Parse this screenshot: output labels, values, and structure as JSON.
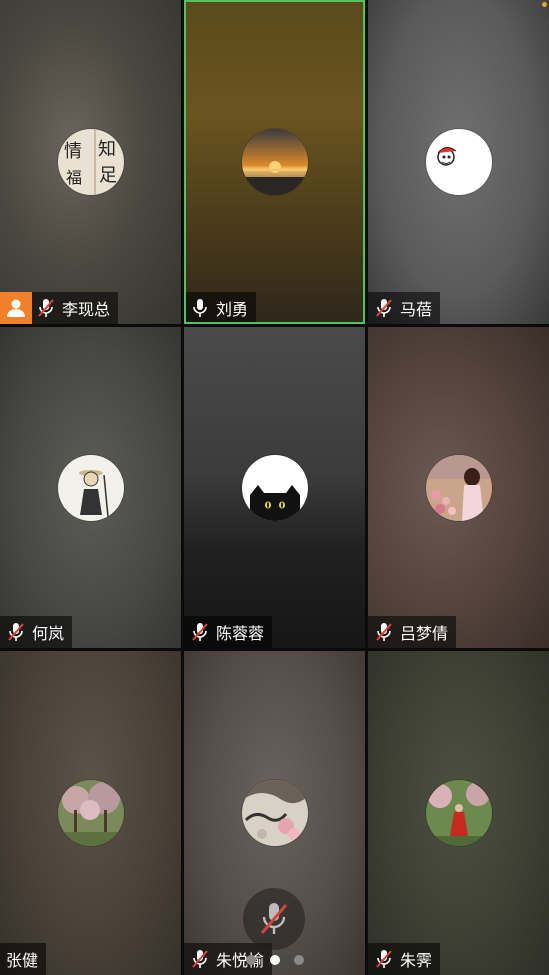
{
  "participants": [
    {
      "name": "李现总",
      "muted": true,
      "host": true,
      "active": false,
      "avatar": "calligraphy-avatar"
    },
    {
      "name": "刘勇",
      "muted": false,
      "host": false,
      "active": true,
      "avatar": "sunset-avatar"
    },
    {
      "name": "马蓓",
      "muted": true,
      "host": false,
      "active": false,
      "avatar": "cartoon-avatar"
    },
    {
      "name": "何岚",
      "muted": true,
      "host": false,
      "active": false,
      "avatar": "figure-avatar"
    },
    {
      "name": "陈蓉蓉",
      "muted": true,
      "host": false,
      "active": false,
      "avatar": "black-cat-avatar"
    },
    {
      "name": "吕梦倩",
      "muted": true,
      "host": false,
      "active": false,
      "avatar": "flowers-girl-avatar"
    },
    {
      "name": "张健",
      "muted": false,
      "host": false,
      "active": false,
      "avatar": "blossom-trees-avatar"
    },
    {
      "name": "朱悦愉",
      "muted": true,
      "host": false,
      "active": false,
      "avatar": "painting-avatar"
    },
    {
      "name": "朱霁",
      "muted": true,
      "host": false,
      "active": false,
      "avatar": "red-dress-avatar"
    }
  ],
  "controls": {
    "mic_state": "muted",
    "page_count": 3,
    "current_page": 2
  },
  "colors": {
    "active_border": "#4fc35d",
    "host_badge": "#f0812a"
  }
}
